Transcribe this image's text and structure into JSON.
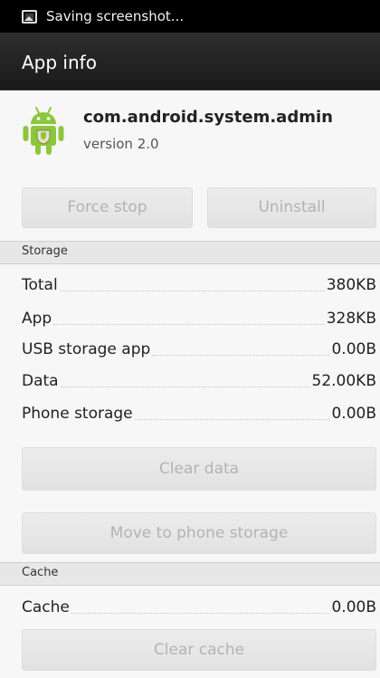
{
  "status_bar": {
    "icon": "image-icon",
    "text": "Saving screenshot..."
  },
  "action_bar": {
    "title": "App info"
  },
  "app": {
    "icon": "android-robot-icon",
    "name": "com.android.system.admin",
    "version": "version 2.0"
  },
  "buttons": {
    "force_stop": "Force stop",
    "uninstall": "Uninstall",
    "clear_data": "Clear data",
    "move_to_phone": "Move to phone storage",
    "clear_cache": "Clear cache"
  },
  "storage": {
    "header": "Storage",
    "rows": [
      {
        "label": "Total",
        "value": "380KB"
      },
      {
        "label": "App",
        "value": "328KB"
      },
      {
        "label": "USB storage app",
        "value": "0.00B"
      },
      {
        "label": "Data",
        "value": "52.00KB"
      },
      {
        "label": "Phone storage",
        "value": "0.00B"
      }
    ]
  },
  "cache": {
    "header": "Cache",
    "rows": [
      {
        "label": "Cache",
        "value": "0.00B"
      }
    ]
  },
  "colors": {
    "status_bar_bg": "#000000",
    "action_bar_bg": "#222222",
    "android_green": "#8cc63e",
    "disabled_text": "#b3b3b3"
  }
}
